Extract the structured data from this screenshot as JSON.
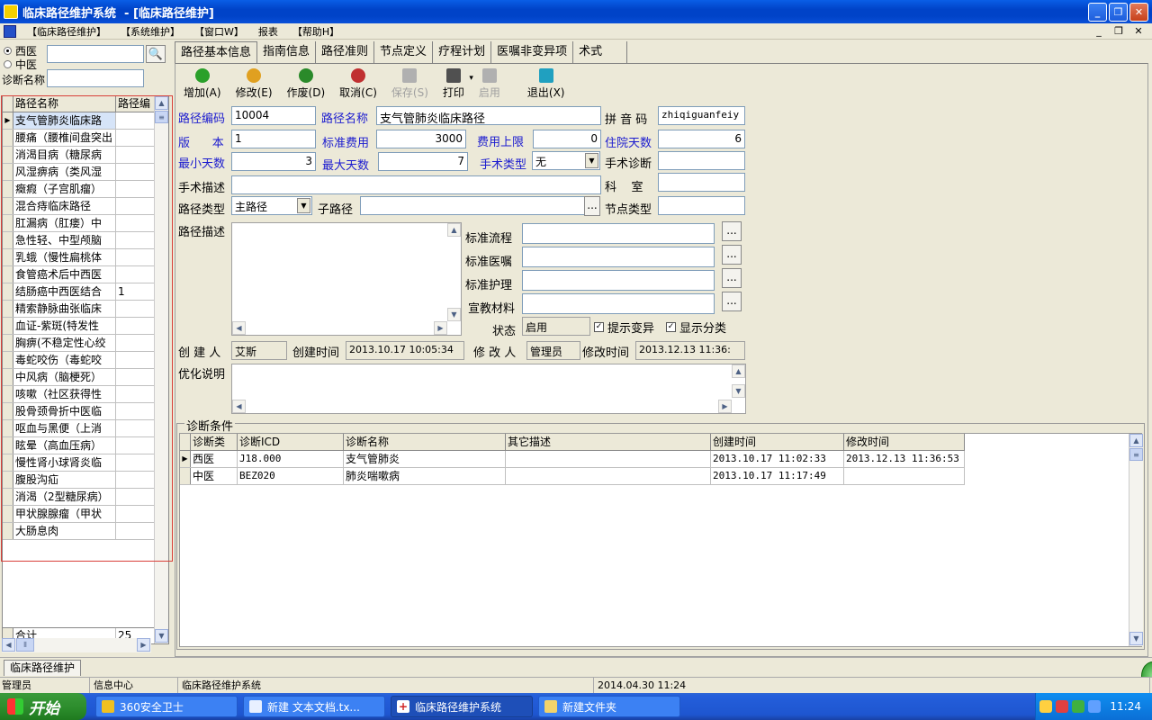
{
  "window": {
    "title": "临床路径维护系统  - [临床路径维护]"
  },
  "menu": [
    "【临床路径维护】",
    "【系统维护】",
    "【窗口W】",
    "报表",
    "【帮助H】"
  ],
  "left": {
    "radio_west": "西医",
    "radio_chinese": "中医",
    "diag_label": "诊断名称",
    "grid": {
      "col_name": "路径名称",
      "col_code": "路径编",
      "rows": [
        {
          "name": "支气管肺炎临床路",
          "val": ""
        },
        {
          "name": "腰痛（腰椎间盘突出",
          "val": ""
        },
        {
          "name": "消渴目病（糖尿病",
          "val": ""
        },
        {
          "name": "风湿痹病（类风湿",
          "val": ""
        },
        {
          "name": "癥瘕（子宫肌瘤）",
          "val": ""
        },
        {
          "name": "混合痔临床路径",
          "val": ""
        },
        {
          "name": "肛漏病（肛瘘）中",
          "val": ""
        },
        {
          "name": "急性轻、中型颅脑",
          "val": ""
        },
        {
          "name": "乳蛾（慢性扁桃体",
          "val": ""
        },
        {
          "name": "食管癌术后中西医",
          "val": ""
        },
        {
          "name": "结肠癌中西医结合",
          "val": "1"
        },
        {
          "name": "精索静脉曲张临床",
          "val": ""
        },
        {
          "name": "血证-紫斑(特发性",
          "val": ""
        },
        {
          "name": "胸痹(不稳定性心绞",
          "val": ""
        },
        {
          "name": "毒蛇咬伤（毒蛇咬",
          "val": ""
        },
        {
          "name": "中风病（脑梗死）",
          "val": ""
        },
        {
          "name": "咳嗽（社区获得性",
          "val": ""
        },
        {
          "name": "股骨颈骨折中医临",
          "val": ""
        },
        {
          "name": "呕血与黑便（上消",
          "val": ""
        },
        {
          "name": "眩晕（高血压病）",
          "val": ""
        },
        {
          "name": "慢性肾小球肾炎临",
          "val": ""
        },
        {
          "name": "腹股沟疝",
          "val": ""
        },
        {
          "name": "消渴（2型糖尿病）",
          "val": ""
        },
        {
          "name": "甲状腺腺瘤（甲状",
          "val": ""
        },
        {
          "name": "大肠息肉",
          "val": ""
        }
      ],
      "sum_label": "合计",
      "sum_val": "25"
    }
  },
  "tabs": [
    "路径基本信息",
    "指南信息",
    "路径准则",
    "节点定义",
    "疗程计划",
    "医嘱非变异项",
    "术式"
  ],
  "toolbar": [
    {
      "label": "增加(A)",
      "icon": "add-icon",
      "color": "#2aa02a",
      "disabled": false
    },
    {
      "label": "修改(E)",
      "icon": "edit-icon",
      "color": "#e0a020",
      "disabled": false
    },
    {
      "label": "作废(D)",
      "icon": "cancel-doc-icon",
      "color": "#2a8a2a",
      "disabled": false
    },
    {
      "label": "取消(C)",
      "icon": "undo-icon",
      "color": "#c03030",
      "disabled": false
    },
    {
      "label": "保存(S)",
      "icon": "save-icon",
      "color": "#b0b0b0",
      "disabled": true
    },
    {
      "label": "打印",
      "icon": "print-icon",
      "color": "#505050",
      "disabled": false
    },
    {
      "label": "启用",
      "icon": "enable-icon",
      "color": "#b0b0b0",
      "disabled": true
    },
    {
      "label": "退出(X)",
      "icon": "exit-icon",
      "color": "#20a0c0",
      "disabled": false
    }
  ],
  "form": {
    "code_label": "路径编码",
    "code": "10004",
    "name_label": "路径名称",
    "name": "支气管肺炎临床路径",
    "pinyin_label": "拼 音 码",
    "pinyin": "zhiqiguanfeiy",
    "version_label": "版      本",
    "version": "1",
    "fee_label": "标准费用",
    "fee": "3000",
    "feemax_label": "费用上限",
    "feemax": "0",
    "days_label": "住院天数",
    "days": "6",
    "mindays_label": "最小天数",
    "mindays": "3",
    "maxdays_label": "最大天数",
    "maxdays": "7",
    "surgtype_label": "手术类型",
    "surgtype": "无",
    "surgdiag_label": "手术诊断",
    "surgdiag": "",
    "surgdesc_label": "手术描述",
    "surgdesc": "",
    "dept_label": "科    室",
    "dept": "",
    "pathtype_label": "路径类型",
    "pathtype": "主路径",
    "subpath_label": "子路径",
    "subpath": "",
    "nodetype_label": "节点类型",
    "nodetype": "",
    "desc_label": "路径描述",
    "stdflow_label": "标准流程",
    "stdorder_label": "标准医嘱",
    "stdnurse_label": "标准护理",
    "edumat_label": "宣教材料",
    "status_label": "状态",
    "status": "启用",
    "chk_variation": "提示变异",
    "chk_category": "显示分类",
    "creator_label": "创 建 人",
    "creator": "艾斯",
    "ctime_label": "创建时间",
    "ctime": "2013.10.17 10:05:34",
    "modifier_label": "修 改 人",
    "modifier": "管理员",
    "mtime_label": "修改时间",
    "mtime": "2013.12.13 11:36:",
    "opt_label": "优化说明"
  },
  "diag": {
    "title": "诊断条件",
    "headers": [
      "诊断类",
      "诊断ICD",
      "诊断名称",
      "其它描述",
      "创建时间",
      "修改时间"
    ],
    "rows": [
      [
        "西医",
        "J18.000",
        "支气管肺炎",
        "",
        "2013.10.17 11:02:33",
        "2013.12.13 11:36:53"
      ],
      [
        "中医",
        "BEZ020",
        "肺炎喘嗽病",
        "",
        "2013.10.17 11:17:49",
        ""
      ]
    ]
  },
  "mdi_tab": "临床路径维护",
  "status": {
    "user": "管理员",
    "dept": "信息中心",
    "system": "临床路径维护系统",
    "datetime": "2014.04.30 11:24"
  },
  "taskbar": {
    "start": "开始",
    "items": [
      "360安全卫士",
      "新建 文本文档.tx...",
      "临床路径维护系统",
      "新建文件夹"
    ],
    "clock": "11:24"
  }
}
